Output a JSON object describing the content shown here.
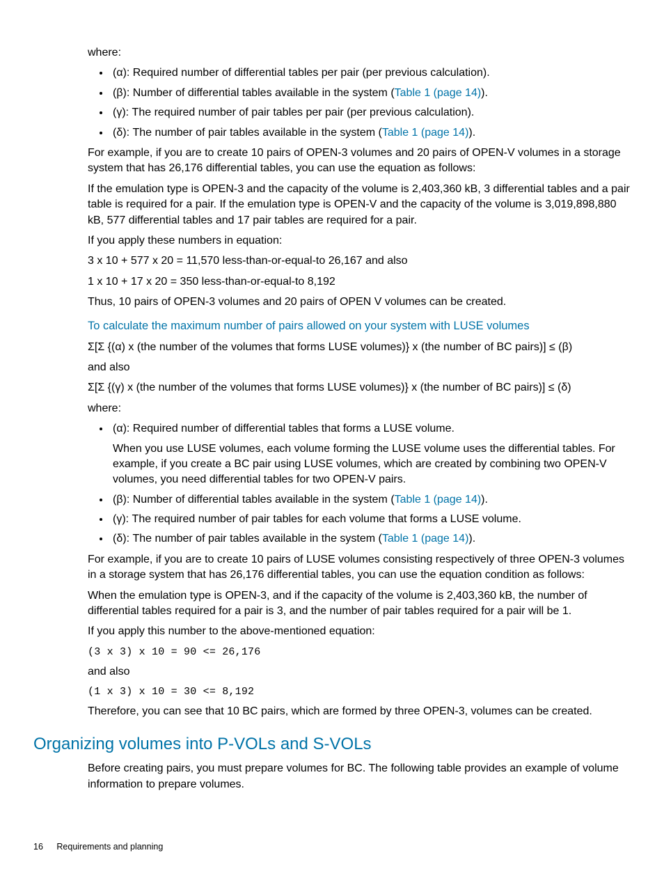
{
  "p_where1": "where:",
  "bullets1": [
    {
      "pre": "(α): Required number of differential tables per pair (per previous calculation).",
      "link": "",
      "post": ""
    },
    {
      "pre": "(β): Number of differential tables available in the system (",
      "link": "Table 1 (page 14)",
      "post": ")."
    },
    {
      "pre": "(γ): The required number of pair tables per pair (per previous calculation).",
      "link": "",
      "post": ""
    },
    {
      "pre": "(δ): The number of pair tables available in the system (",
      "link": "Table 1 (page 14)",
      "post": ")."
    }
  ],
  "p_example1": "For example, if you are to create 10 pairs of OPEN-3 volumes and 20 pairs of OPEN-V volumes in a storage system that has 26,176 differential tables, you can use the equation as follows:",
  "p_emulation": "If the emulation type is OPEN-3 and the capacity of the volume is 2,403,360 kB, 3 differential tables and a pair table is required for a pair. If the emulation type is OPEN-V and the capacity of the volume is 3,019,898,880 kB, 577 differential tables and 17 pair tables are required for a pair.",
  "p_apply1": "If you apply these numbers in equation:",
  "p_eq1": "3 x 10 + 577 x 20 = 11,570 less-than-or-equal-to 26,167 and also",
  "p_eq2": "1 x 10 + 17 x 20 = 350 less-than-or-equal-to 8,192",
  "p_thus": "Thus, 10 pairs of OPEN-3 volumes and 20 pairs of OPEN V volumes can be created.",
  "link_luse": "To calculate the maximum number of pairs allowed on your system with LUSE volumes",
  "p_sigma1": "Σ[Σ {(α) x (the number of the volumes that forms LUSE volumes)} x (the number of BC pairs)] ≤ (β)",
  "p_andalso1": "and also",
  "p_sigma2": "Σ[Σ {(γ) x (the number of the volumes that forms LUSE volumes)} x (the number of BC pairs)] ≤ (δ)",
  "p_where2": "where:",
  "bullets2": {
    "b1_line1": "(α): Required number of differential tables that forms a LUSE volume.",
    "b1_line2": "When you use LUSE volumes, each volume forming the LUSE volume uses the differential tables. For example, if you create a BC pair using LUSE volumes, which are created by combining two OPEN-V volumes, you need differential tables for two OPEN-V pairs.",
    "b2_pre": "(β): Number of differential tables available in the system (",
    "b2_link": "Table 1 (page 14)",
    "b2_post": ").",
    "b3": "(γ): The required number of pair tables for each volume that forms a LUSE volume.",
    "b4_pre": "(δ): The number of pair tables available in the system (",
    "b4_link": "Table 1 (page 14)",
    "b4_post": ")."
  },
  "p_example2": "For example, if you are to create 10 pairs of LUSE volumes consisting respectively of three OPEN-3 volumes in a storage system that has 26,176 differential tables, you can use the equation condition as follows:",
  "p_whenemul": "When the emulation type is OPEN-3, and if the capacity of the volume is 2,403,360 kB, the number of differential tables required for a pair is 3, and the number of pair tables required for a pair will be 1.",
  "p_apply2": "If you apply this number to the above-mentioned equation:",
  "p_mono1": "(3 x 3) x 10 = 90 <= 26,176",
  "p_andalso2": "and also",
  "p_mono2": "(1 x 3) x 10 = 30 <= 8,192",
  "p_therefore": "Therefore, you can see that 10 BC pairs, which are formed by three OPEN-3, volumes can be created.",
  "h2_org": "Organizing volumes into P-VOLs and S-VOLs",
  "p_before": "Before creating pairs, you must prepare volumes for BC. The following table provides an example of volume information to prepare volumes.",
  "footer_page": "16",
  "footer_text": "Requirements and planning"
}
